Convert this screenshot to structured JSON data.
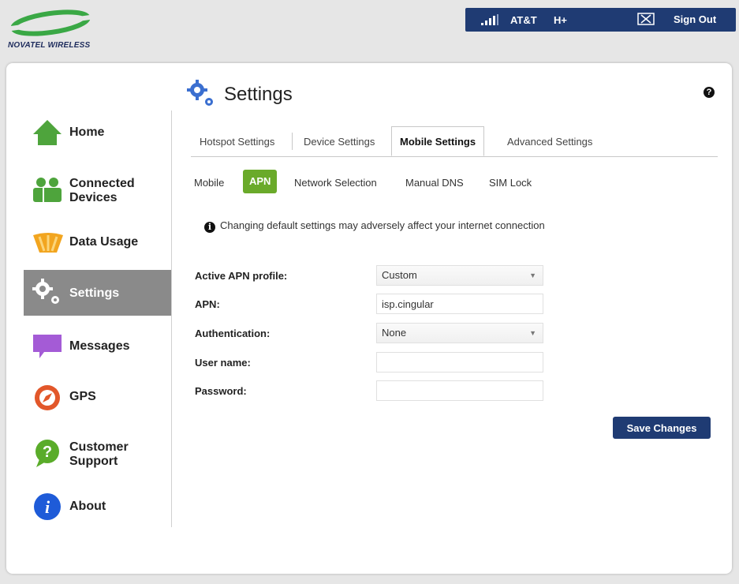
{
  "brand": {
    "logo_text": "NOVATEL WIRELESS"
  },
  "status_bar": {
    "carrier": "AT&T",
    "network_type": "H+",
    "messages_icon": "envelope-icon",
    "sign_out_label": "Sign Out"
  },
  "page": {
    "title": "Settings"
  },
  "sidebar": {
    "items": [
      {
        "label": "Home",
        "icon": "house-icon"
      },
      {
        "label": "Connected Devices",
        "icon": "connected-devices-icon"
      },
      {
        "label": "Data Usage",
        "icon": "gauge-icon"
      },
      {
        "label": "Settings",
        "icon": "gears-icon",
        "active": true
      },
      {
        "label": "Messages",
        "icon": "speech-bubble-icon"
      },
      {
        "label": "GPS",
        "icon": "compass-icon"
      },
      {
        "label": "Customer Support",
        "icon": "question-bubble-icon"
      },
      {
        "label": "About",
        "icon": "info-icon"
      }
    ]
  },
  "tabs": [
    {
      "label": "Hotspot Settings"
    },
    {
      "label": "Device Settings"
    },
    {
      "label": "Mobile Settings",
      "active": true
    },
    {
      "label": "Advanced Settings"
    }
  ],
  "subtabs": [
    {
      "label": "Mobile"
    },
    {
      "label": "APN",
      "active": true
    },
    {
      "label": "Network Selection"
    },
    {
      "label": "Manual DNS"
    },
    {
      "label": "SIM Lock"
    }
  ],
  "warning_text": "Changing default settings may adversely affect your internet connection",
  "form": {
    "active_apn_profile": {
      "label": "Active APN profile:",
      "value": "Custom"
    },
    "apn": {
      "label": "APN:",
      "value": "isp.cingular"
    },
    "authentication": {
      "label": "Authentication:",
      "value": "None"
    },
    "user_name": {
      "label": "User name:",
      "value": ""
    },
    "password": {
      "label": "Password:",
      "value": ""
    }
  },
  "save_label": "Save Changes",
  "colors": {
    "brand_navy": "#1f3b73",
    "active_green": "#6aaa2a",
    "active_nav_gray": "#8a8a8a"
  }
}
